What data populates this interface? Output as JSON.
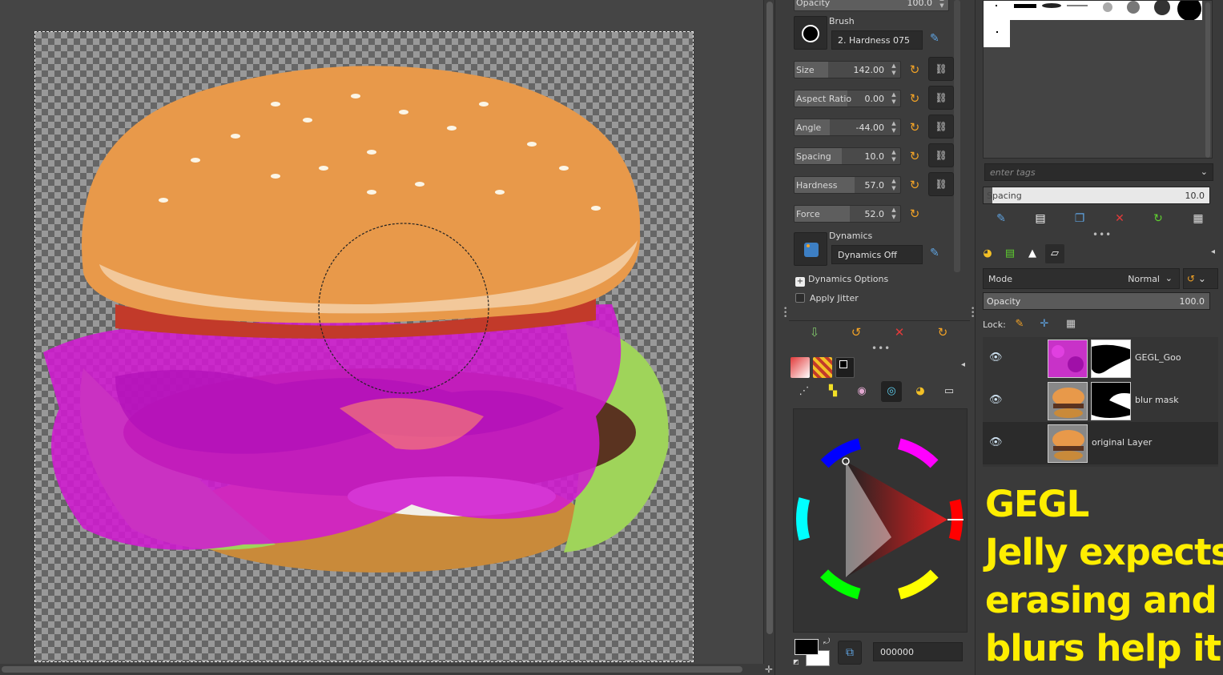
{
  "canvas": {
    "image_description_label": "burger with magenta GEGL jelly effect"
  },
  "tool_options": {
    "opacity": {
      "label": "Opacity",
      "value": "100.0",
      "fraction": 1.0
    },
    "brush": {
      "label": "Brush",
      "name": "2. Hardness 075"
    },
    "sliders": [
      {
        "label": "Size",
        "value": "142.00",
        "fraction": 0.32
      },
      {
        "label": "Aspect Ratio",
        "value": "0.00",
        "fraction": 0.5
      },
      {
        "label": "Angle",
        "value": "-44.00",
        "fraction": 0.33
      },
      {
        "label": "Spacing",
        "value": "10.0",
        "fraction": 0.45
      },
      {
        "label": "Hardness",
        "value": "57.0",
        "fraction": 0.57
      },
      {
        "label": "Force",
        "value": "52.0",
        "fraction": 0.52
      }
    ],
    "dynamics": {
      "label": "Dynamics",
      "name": "Dynamics Off"
    },
    "dynamics_options_label": "Dynamics Options",
    "apply_jitter_label": "Apply Jitter"
  },
  "colors": {
    "foreground": "#000000",
    "background": "#ffffff",
    "hex_value": "000000"
  },
  "brushes": {
    "tags_placeholder": "enter tags",
    "spacing": {
      "label": "Spacing",
      "value": "10.0"
    }
  },
  "layers": {
    "mode": {
      "label": "Mode",
      "value": "Normal"
    },
    "opacity": {
      "label": "Opacity",
      "value": "100.0"
    },
    "lock_label": "Lock:",
    "items": [
      {
        "name": "GEGL_Goo",
        "visible": true,
        "has_mask": true
      },
      {
        "name": "blur mask",
        "visible": true,
        "has_mask": true
      },
      {
        "name": "original Layer",
        "visible": true,
        "has_mask": false
      }
    ]
  },
  "overlay": {
    "line1": "GEGL",
    "line2": "Jelly expects",
    "line3": "erasing and",
    "line4": "blurs help it"
  },
  "accent_colors": {
    "reset": "#f3a326",
    "overlay_text": "#ffee00",
    "goo": "#d01ad0"
  }
}
